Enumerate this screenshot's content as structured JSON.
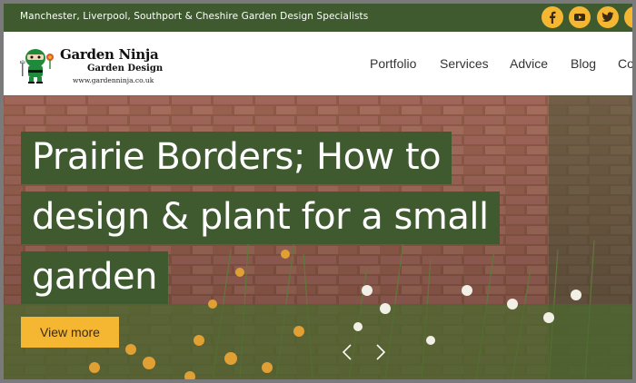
{
  "topbar": {
    "tagline": "Manchester, Liverpool, Southport & Cheshire Garden Design Specialists",
    "social": [
      {
        "icon": "facebook-icon",
        "glyph": "f"
      },
      {
        "icon": "youtube-icon",
        "glyph": "You Tube"
      },
      {
        "icon": "twitter-icon",
        "glyph": "t"
      },
      {
        "icon": "instagram-icon",
        "glyph": ""
      }
    ]
  },
  "logo": {
    "title": "Garden Ninja",
    "subtitle": "Garden Design",
    "url": "www.gardenninja.co.uk"
  },
  "nav": {
    "items": [
      "Portfolio",
      "Services",
      "Advice",
      "Blog",
      "Co"
    ]
  },
  "hero": {
    "title_lines": [
      "Prairie Borders; How to",
      "design & plant for a small",
      "garden"
    ],
    "cta_label": "View more"
  },
  "colors": {
    "brand_green": "#3f5a2e",
    "accent_yellow": "#f5b731",
    "frame_gray": "#7a7a7a"
  }
}
